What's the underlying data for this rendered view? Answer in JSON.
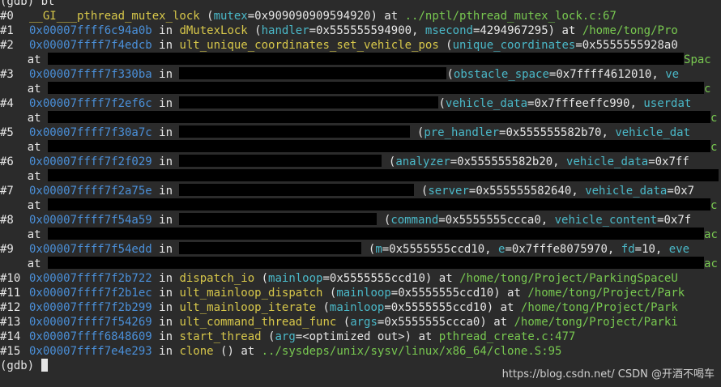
{
  "top_partial": "(gdb) bt",
  "frames": [
    {
      "num": "#0",
      "func": "__GI___pthread_mutex_lock",
      "param": "mutex",
      "val": "=0x909090909594920",
      "tail": ") at ",
      "path": "../nptl/pthread_mutex_lock.c:67"
    },
    {
      "num": "#1",
      "addr": "0x00007ffff6c94a0b",
      "func": "dMutexLock",
      "p1": "handler",
      "v1": "=0x555555594900, ",
      "p2": "msecond",
      "v2": "=4294967295",
      "tail": ") at ",
      "path": "/home/tong/Pro"
    },
    {
      "num": "#2",
      "addr": "0x00007ffff7f4edcb",
      "func": "ult_unique_coordinates_set_vehicle_pos",
      "p1": "unique_coordinates",
      "v1": "=0x5555555928a0",
      "at": "at",
      "cont": "Spac"
    },
    {
      "num": "#3",
      "addr": "0x00007ffff7f330ba",
      "p1": "obstacle_space",
      "v1": "=0x7ffff4612010, ",
      "p2": "ve",
      "at": "at",
      "cont": "c"
    },
    {
      "num": "#4",
      "addr": "0x00007ffff7f2ef6c",
      "p1": "vehicle_data",
      "v1": "=0x7fffeeffc990, ",
      "p2": "userdat",
      "at": "at",
      "cont": "c"
    },
    {
      "num": "#5",
      "addr": "0x00007ffff7f30a7c",
      "p1": "pre_handler",
      "v1": "=0x555555582b70, ",
      "p2": "vehicle_dat",
      "at": "at",
      "cont": "c"
    },
    {
      "num": "#6",
      "addr": "0x00007ffff7f2f029",
      "p1": "analyzer",
      "v1": "=0x555555582b20, ",
      "p2": "vehicle_data",
      "v2": "=0x7ff",
      "at": "at",
      "cont": ""
    },
    {
      "num": "#7",
      "addr": "0x00007ffff7f2a75e",
      "p1": "server",
      "v1": "=0x555555582640, ",
      "p2": "vehicle_data",
      "v2": "=0x7",
      "at": "at",
      "cont": "c"
    },
    {
      "num": "#8",
      "addr": "0x00007ffff7f54a59",
      "p1": "command",
      "v1": "=0x5555555ccca0, ",
      "p2": "vehicle_content",
      "v2": "=0x7f",
      "at": "at",
      "cont": "ac"
    },
    {
      "num": "#9",
      "addr": "0x00007ffff7f54edd",
      "p1": "m",
      "v1": "=0x5555555ccd10, ",
      "p2": "e",
      "v2": "=0x7fffe8075970, ",
      "p3": "fd",
      "v3": "=10, ",
      "p4": "eve",
      "at": "at",
      "cont": "ac"
    },
    {
      "num": "#10",
      "addr": "0x00007ffff7f2b722",
      "func": "dispatch_io",
      "p1": "mainloop",
      "v1": "=0x5555555ccd10",
      "tail": ") at ",
      "path": "/home/tong/Project/ParkingSpaceU"
    },
    {
      "num": "#11",
      "addr": "0x00007ffff7f2b1ec",
      "func": "ult_mainloop_dispatch",
      "p1": "mainloop",
      "v1": "=0x5555555ccd10",
      "tail": ") at ",
      "path": "/home/tong/Project/Park"
    },
    {
      "num": "#12",
      "addr": "0x00007ffff7f2b299",
      "func": "ult_mainloop_iterate",
      "p1": "mainloop",
      "v1": "=0x5555555ccd10",
      "tail": ") at ",
      "path": "/home/tong/Project/Park"
    },
    {
      "num": "#13",
      "addr": "0x00007ffff7f54269",
      "func": "ult_command_thread_func",
      "p1": "args",
      "v1": "=0x5555555ccca0",
      "tail": ") at ",
      "path": "/home/tong/Project/Parki"
    },
    {
      "num": "#14",
      "addr": "0x00007ffff6848609",
      "func": "start_thread",
      "p1": "arg",
      "v1": "=<optimized out>",
      "tail": ") at ",
      "path": "pthread_create.c:477"
    },
    {
      "num": "#15",
      "addr": "0x00007ffff7e4e293",
      "func": "clone",
      "tail": " () at ",
      "path": "../sysdeps/unix/sysv/linux/x86_64/clone.S:95"
    }
  ],
  "in_word": "in",
  "prompt": "(gdb)",
  "watermark": "https://blog.csdn.net/ CSDN @开酒不喝车"
}
